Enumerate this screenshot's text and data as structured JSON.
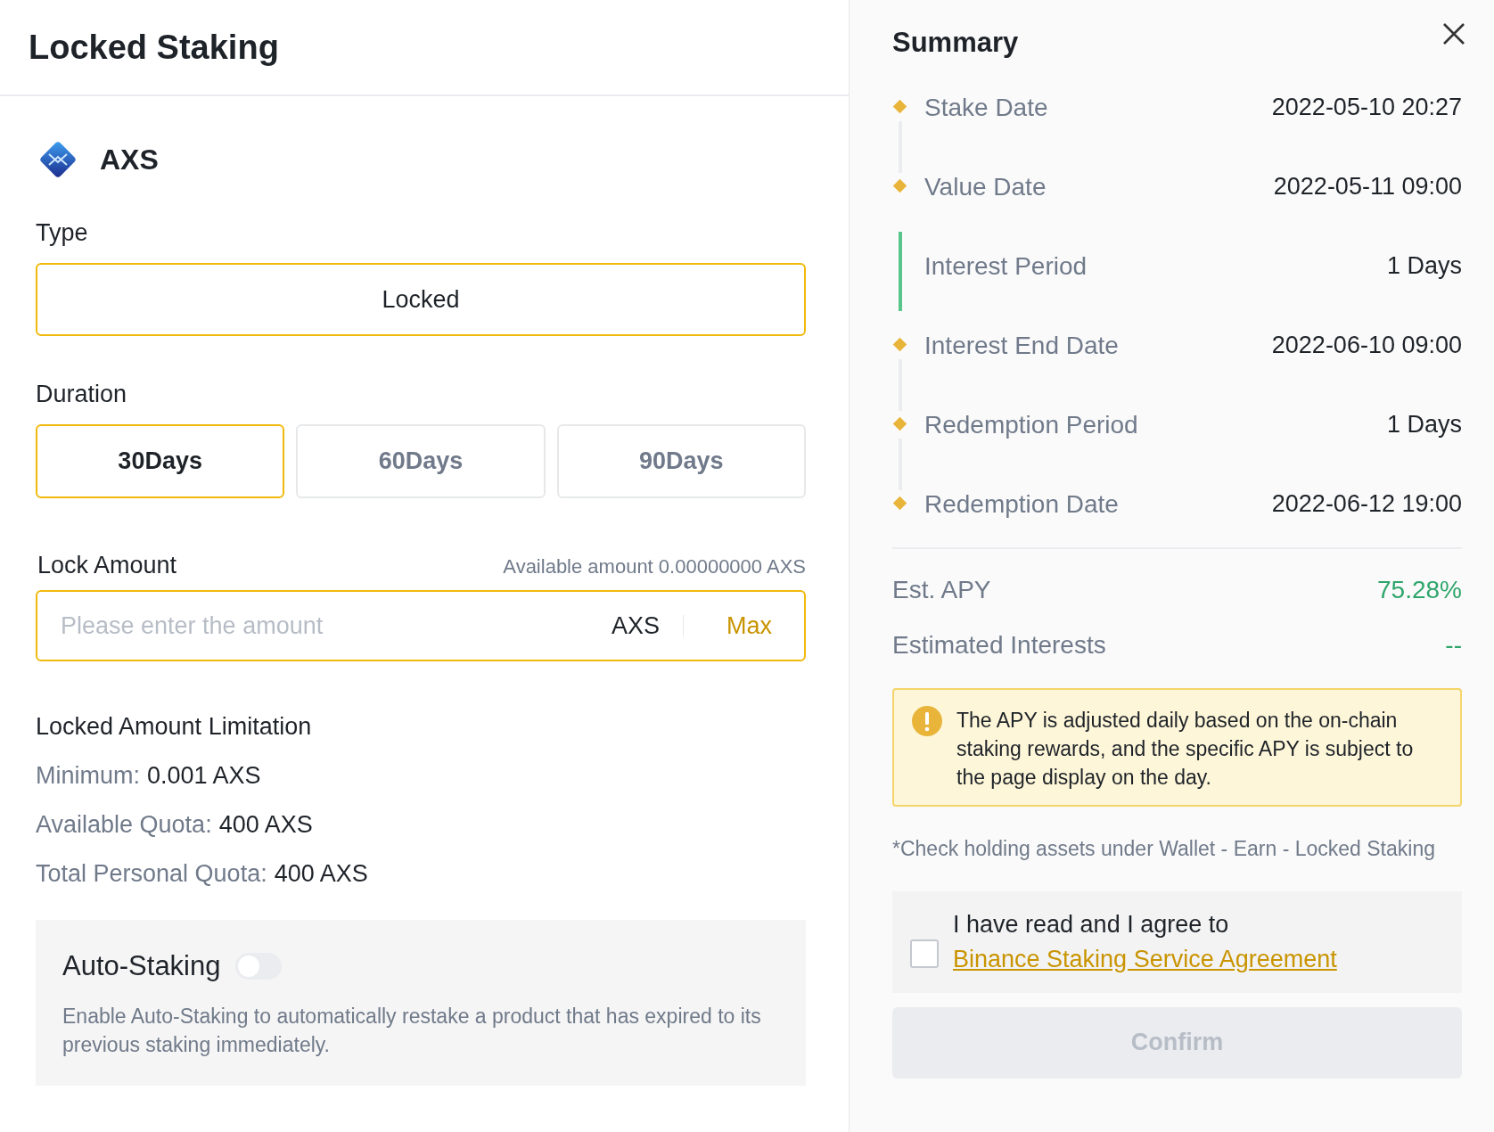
{
  "header": {
    "title": "Locked Staking"
  },
  "coin": {
    "symbol": "AXS"
  },
  "type": {
    "label": "Type",
    "value": "Locked"
  },
  "duration": {
    "label": "Duration",
    "options": [
      {
        "label": "30Days",
        "selected": true
      },
      {
        "label": "60Days",
        "selected": false
      },
      {
        "label": "90Days",
        "selected": false
      }
    ]
  },
  "lock_amount": {
    "label": "Lock Amount",
    "available": "Available amount 0.00000000 AXS",
    "placeholder": "Please enter the amount",
    "unit": "AXS",
    "max": "Max"
  },
  "limitation": {
    "title": "Locked Amount Limitation",
    "items": [
      {
        "label": "Minimum:",
        "value": "0.001 AXS"
      },
      {
        "label": "Available Quota:",
        "value": "400 AXS"
      },
      {
        "label": "Total Personal Quota:",
        "value": "400 AXS"
      }
    ]
  },
  "auto_staking": {
    "label": "Auto-Staking",
    "on": false,
    "description": "Enable Auto-Staking to automatically restake a product that has expired to its previous staking immediately."
  },
  "summary": {
    "title": "Summary",
    "timeline": [
      {
        "kind": "date",
        "label": "Stake Date",
        "value": "2022-05-10 20:27"
      },
      {
        "kind": "date",
        "label": "Value Date",
        "value": "2022-05-11 09:00"
      },
      {
        "kind": "period",
        "label": "Interest Period",
        "value": "1 Days"
      },
      {
        "kind": "date",
        "label": "Interest End Date",
        "value": "2022-06-10 09:00"
      },
      {
        "kind": "date",
        "label": "Redemption Period",
        "value": "1 Days"
      },
      {
        "kind": "date",
        "label": "Redemption Date",
        "value": "2022-06-12 19:00"
      }
    ],
    "apy": {
      "label": "Est. APY",
      "value": "75.28%"
    },
    "interests": {
      "label": "Estimated Interests",
      "value": "--"
    },
    "notice": "The APY is adjusted daily based on the on-chain staking rewards, and the specific APY is subject to the page display on the day.",
    "hint": "*Check holding assets under Wallet - Earn - Locked Staking",
    "agreement": {
      "checked": false,
      "text": "I have read and I agree to",
      "link": "Binance Staking Service Agreement"
    },
    "confirm": {
      "label": "Confirm",
      "disabled": true
    }
  }
}
